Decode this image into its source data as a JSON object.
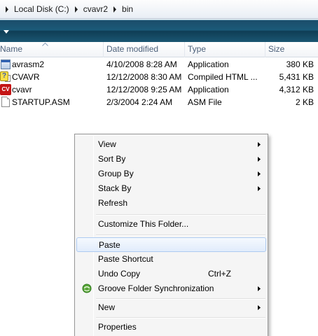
{
  "breadcrumb": {
    "items": [
      "Local Disk (C:)",
      "cvavr2",
      "bin"
    ]
  },
  "columns": {
    "name": "Name",
    "date": "Date modified",
    "type": "Type",
    "size": "Size"
  },
  "files": [
    {
      "icon": "application-icon",
      "name": "avrasm2",
      "date": "4/10/2008 8:28 AM",
      "type": "Application",
      "size": "380 KB"
    },
    {
      "icon": "chm-help-icon",
      "name": "CVAVR",
      "date": "12/12/2008 8:30 AM",
      "type": "Compiled HTML ...",
      "size": "5,431 KB"
    },
    {
      "icon": "codevision-icon",
      "name": "cvavr",
      "date": "12/12/2008 9:25 AM",
      "type": "Application",
      "size": "4,312 KB"
    },
    {
      "icon": "document-icon",
      "name": "STARTUP.ASM",
      "date": "2/3/2004 2:24 AM",
      "type": "ASM File",
      "size": "2 KB"
    }
  ],
  "context_menu": {
    "items": [
      {
        "label": "View",
        "submenu": true
      },
      {
        "label": "Sort By",
        "submenu": true
      },
      {
        "label": "Group By",
        "submenu": true
      },
      {
        "label": "Stack By",
        "submenu": true
      },
      {
        "label": "Refresh"
      },
      {
        "label": "Customize This Folder..."
      },
      {
        "label": "Paste",
        "highlighted": true
      },
      {
        "label": "Paste Shortcut"
      },
      {
        "label": "Undo Copy",
        "shortcut": "Ctrl+Z"
      },
      {
        "label": "Groove Folder Synchronization",
        "submenu": true,
        "icon": "groove-icon"
      },
      {
        "label": "New",
        "submenu": true
      },
      {
        "label": "Properties"
      }
    ]
  },
  "colors": {
    "command_bar": "#1b5a79",
    "header_text": "#4c607a",
    "menu_highlight_border": "#aecbf1"
  }
}
